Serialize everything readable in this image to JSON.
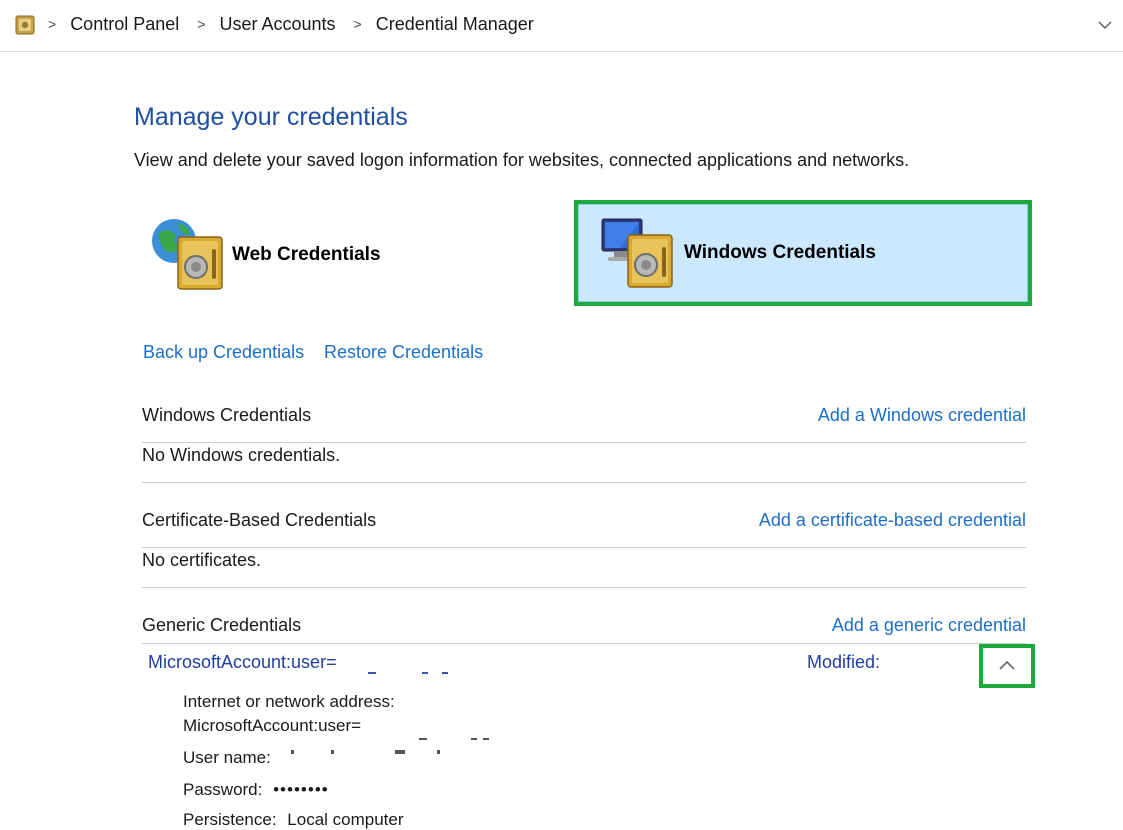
{
  "breadcrumb": {
    "items": [
      "Control Panel",
      "User Accounts",
      "Credential Manager"
    ]
  },
  "page": {
    "title": "Manage your credentials",
    "subtitle": "View and delete your saved logon information for websites, connected applications and networks."
  },
  "tiles": {
    "web": {
      "label": "Web Credentials",
      "icon": "web-credentials-vault-icon"
    },
    "windows": {
      "label": "Windows Credentials",
      "icon": "windows-credentials-vault-icon",
      "selected": true
    }
  },
  "links": {
    "backup": "Back up Credentials",
    "restore": "Restore Credentials"
  },
  "sections": {
    "windows": {
      "name": "Windows Credentials",
      "add": "Add a Windows credential",
      "empty": "No Windows credentials."
    },
    "certificate": {
      "name": "Certificate-Based Credentials",
      "add": "Add a certificate-based credential",
      "empty": "No certificates."
    },
    "generic": {
      "name": "Generic Credentials",
      "add": "Add a generic credential"
    }
  },
  "entry": {
    "name": "MicrosoftAccount:user=",
    "modified_label": "Modified:",
    "details": {
      "address_label": "Internet or network address:",
      "address_value": "MicrosoftAccount:user=",
      "username_label": "User name:",
      "password_label": "Password:",
      "password_value": "••••••••",
      "persistence_label": "Persistence:",
      "persistence_value": "Local computer"
    }
  },
  "colors": {
    "link": "#1c6fc9",
    "title": "#1e4fa0",
    "highlight": "#1daa3c",
    "selected_tile": "#cce8ff"
  }
}
